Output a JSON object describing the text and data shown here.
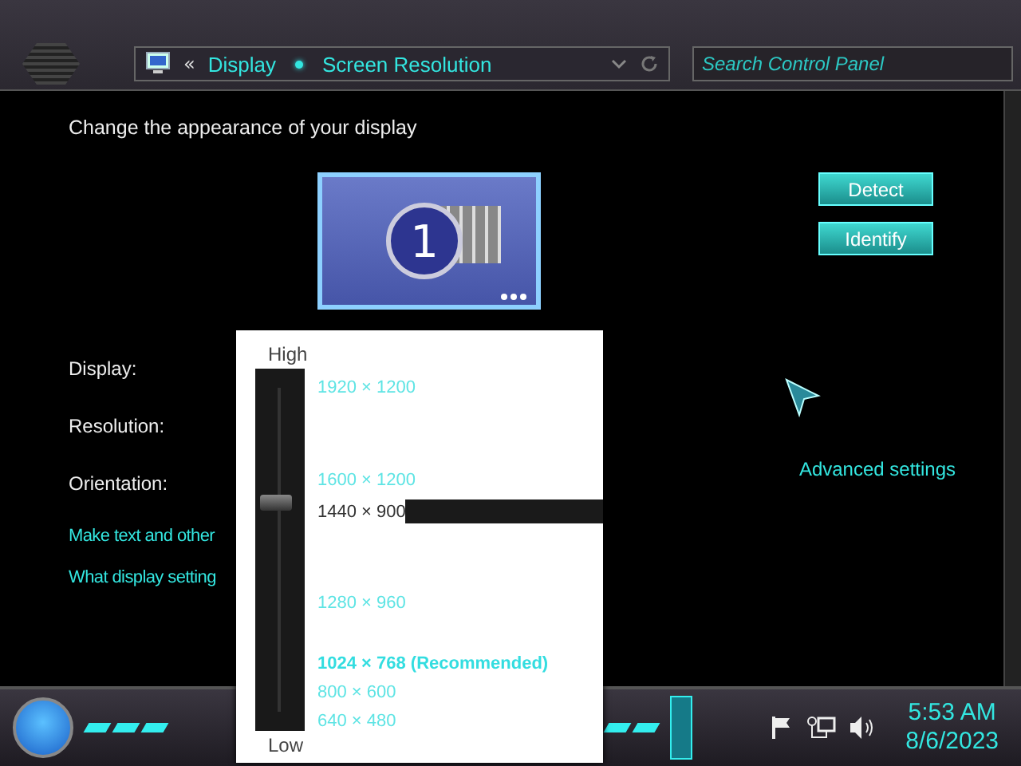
{
  "address_bar": {
    "back": "«",
    "crumbs": [
      "Display",
      "Screen Resolution"
    ]
  },
  "search": {
    "placeholder": "Search Control Panel"
  },
  "heading": "Change the appearance of your display",
  "monitor": {
    "number": "1"
  },
  "buttons": [
    "Detect",
    "Identify"
  ],
  "fields": [
    "Display:",
    "Resolution:",
    "Orientation:"
  ],
  "advanced_link": "Advanced settings",
  "links": [
    "Make text and other",
    "What display setting"
  ],
  "resolution_popup": {
    "high": "High",
    "low": "Low",
    "level": 0.63,
    "options": [
      {
        "label": "1920 × 1200",
        "selected": false,
        "recommended": false
      },
      {
        "label": "1600 × 1200",
        "selected": false,
        "recommended": false
      },
      {
        "label": "1440 × 900",
        "selected": true,
        "recommended": false
      },
      {
        "label": "1280 × 960",
        "selected": false,
        "recommended": false
      },
      {
        "label": "1024 × 768 (Recommended)",
        "selected": false,
        "recommended": true
      },
      {
        "label": "800 × 600",
        "selected": false,
        "recommended": false
      },
      {
        "label": "640 × 480",
        "selected": false,
        "recommended": false
      }
    ]
  },
  "taskbar": {
    "time": "5:53 AM",
    "date": "8/6/2023"
  }
}
